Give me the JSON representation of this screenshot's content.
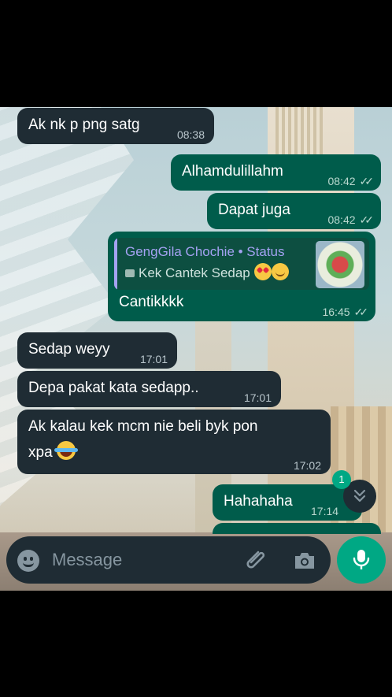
{
  "messages": [
    {
      "dir": "in",
      "text": "Ak nk p png satg",
      "time": "08:38"
    },
    {
      "dir": "out",
      "text": "Alhamdulillahm",
      "time": "08:42"
    },
    {
      "dir": "out",
      "text": "Dapat juga",
      "time": "08:42"
    },
    {
      "dir": "out",
      "reply_author": "GengGila Chochie • Status",
      "reply_text": "Kek Cantek Sedap",
      "text": "Cantikkkk",
      "time": "16:45"
    },
    {
      "dir": "in",
      "text": "Sedap weyy",
      "time": "17:01"
    },
    {
      "dir": "in",
      "text": "Depa pakat kata sedapp..",
      "time": "17:01"
    },
    {
      "dir": "in",
      "text_line1": "Ak kalau kek mcm nie beli byk pon",
      "text_line2": "xpa",
      "time": "17:02"
    },
    {
      "dir": "out",
      "text": "Hahahaha",
      "time": "17:14"
    }
  ],
  "scroll_down": {
    "unread_count": "1"
  },
  "composer": {
    "placeholder": "Message"
  },
  "colors": {
    "incoming": "#1f2c34",
    "outgoing": "#005c4b",
    "accent": "#00a884",
    "quote_author": "#a4a2f2"
  },
  "icons": {
    "emoji": "emoji-icon",
    "attach": "paperclip-icon",
    "camera": "camera-icon",
    "mic": "mic-icon",
    "scroll": "double-chevron-down-icon",
    "read": "double-check-icon"
  }
}
